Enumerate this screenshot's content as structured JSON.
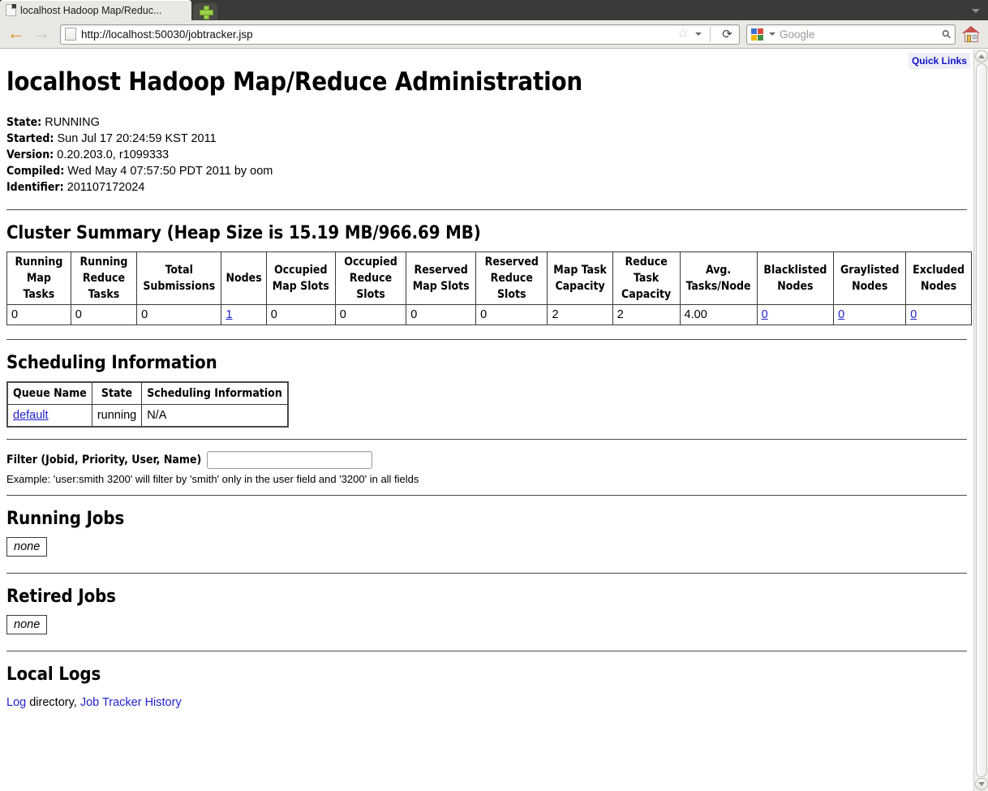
{
  "browser": {
    "tab": {
      "title": "localhost Hadoop Map/Reduc...",
      "favicon": "page-icon"
    },
    "newtab_label": "+",
    "nav": {
      "back": "←",
      "forward": "→",
      "reload": "⟳",
      "url": "http://localhost:50030/jobtracker.jsp",
      "star": "☆",
      "home": "home-icon"
    },
    "search": {
      "placeholder": "Google",
      "engine": "google-icon",
      "magnifier": "⚲"
    }
  },
  "page": {
    "quick_links": "Quick Links",
    "title": "localhost Hadoop Map/Reduce Administration",
    "meta": [
      {
        "label": "State:",
        "value": "RUNNING"
      },
      {
        "label": "Started:",
        "value": "Sun Jul 17 20:24:59 KST 2011"
      },
      {
        "label": "Version:",
        "value": "0.20.203.0, r1099333"
      },
      {
        "label": "Compiled:",
        "value": "Wed May 4 07:57:50 PDT 2011 by oom"
      },
      {
        "label": "Identifier:",
        "value": "201107172024"
      }
    ],
    "cluster_summary": {
      "heading": "Cluster Summary (Heap Size is 15.19 MB/966.69 MB)",
      "headers": [
        "Running Map Tasks",
        "Running Reduce Tasks",
        "Total Submissions",
        "Nodes",
        "Occupied Map Slots",
        "Occupied Reduce Slots",
        "Reserved Map Slots",
        "Reserved Reduce Slots",
        "Map Task Capacity",
        "Reduce Task Capacity",
        "Avg. Tasks/Node",
        "Blacklisted Nodes",
        "Graylisted Nodes",
        "Excluded Nodes"
      ],
      "row": [
        {
          "value": "0",
          "link": false
        },
        {
          "value": "0",
          "link": false
        },
        {
          "value": "0",
          "link": false
        },
        {
          "value": "1",
          "link": true
        },
        {
          "value": "0",
          "link": false
        },
        {
          "value": "0",
          "link": false
        },
        {
          "value": "0",
          "link": false
        },
        {
          "value": "0",
          "link": false
        },
        {
          "value": "2",
          "link": false
        },
        {
          "value": "2",
          "link": false
        },
        {
          "value": "4.00",
          "link": false
        },
        {
          "value": "0",
          "link": true
        },
        {
          "value": "0",
          "link": true
        },
        {
          "value": "0",
          "link": true
        }
      ]
    },
    "scheduling": {
      "heading": "Scheduling Information",
      "headers": [
        "Queue Name",
        "State",
        "Scheduling Information"
      ],
      "rows": [
        {
          "queue_name": "default",
          "state": "running",
          "info": "N/A"
        }
      ]
    },
    "filter": {
      "label": "Filter (Jobid, Priority, User, Name)",
      "value": "",
      "placeholder": "",
      "example": "Example: 'user:smith 3200' will filter by 'smith' only in the user field and '3200' in all fields"
    },
    "running_jobs": {
      "heading": "Running Jobs",
      "empty": "none"
    },
    "retired_jobs": {
      "heading": "Retired Jobs",
      "empty": "none"
    },
    "local_logs": {
      "heading": "Local Logs",
      "log_link": "Log",
      "directory_text": " directory, ",
      "history_link": "Job Tracker History"
    }
  },
  "colors": {
    "link": "#2222cc",
    "quicklinks": "#1414cc",
    "back_arrow": "#e8821e",
    "forward_arrow": "#c3c2bd",
    "tab_bar": "#3a3a38",
    "toolbar": "#e9e8e4"
  }
}
